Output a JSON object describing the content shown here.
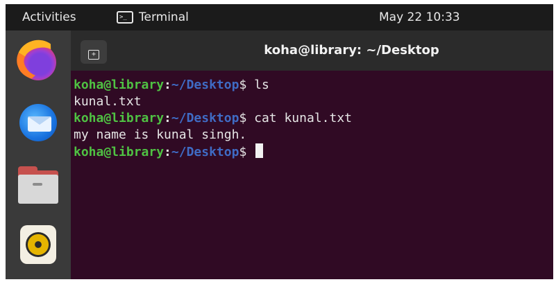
{
  "topbar": {
    "activities": "Activities",
    "app_name": "Terminal",
    "app_icon": "terminal-icon",
    "clock": "May 22  10:33"
  },
  "dock": {
    "items": [
      {
        "name": "firefox",
        "icon": "firefox-icon"
      },
      {
        "name": "thunderbird",
        "icon": "thunderbird-icon"
      },
      {
        "name": "files",
        "icon": "files-icon"
      },
      {
        "name": "rhythmbox",
        "icon": "rhythmbox-icon"
      }
    ]
  },
  "window": {
    "title": "koha@library: ~/Desktop",
    "new_tab_icon": "new-tab-icon"
  },
  "terminal": {
    "prompt_user": "koha@library",
    "prompt_colon": ":",
    "prompt_path": "~/Desktop",
    "prompt_symbol": "$ ",
    "lines": [
      {
        "type": "command",
        "text": "ls"
      },
      {
        "type": "output",
        "text": "kunal.txt"
      },
      {
        "type": "command",
        "text": "cat kunal.txt"
      },
      {
        "type": "output",
        "text": "my name is kunal singh."
      },
      {
        "type": "command",
        "text": ""
      }
    ]
  },
  "colors": {
    "terminal_bg": "#300a24",
    "prompt_user": "#4fc243",
    "prompt_path": "#3f6bc4",
    "topbar_bg": "#1b1b1b",
    "dock_bg": "#3a3a3a"
  }
}
